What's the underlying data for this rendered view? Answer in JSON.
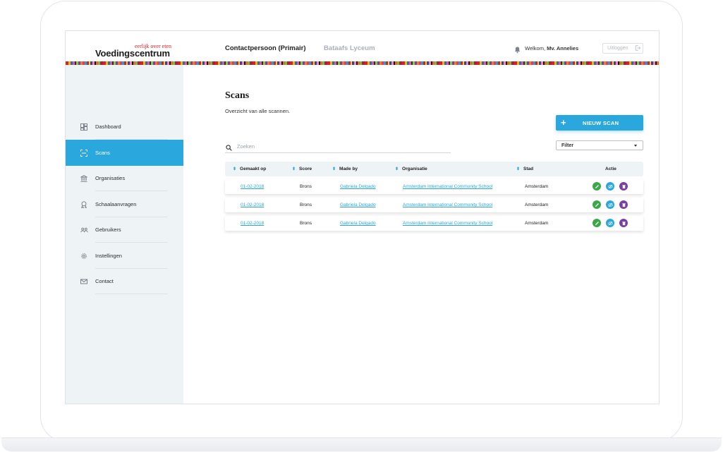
{
  "header": {
    "logo_tagline": "eerlijk over eten",
    "logo_name": "Voedingscentrum",
    "nav_primary": "Contactpersoon (Primair)",
    "nav_secondary": "Bataafs Lyceum",
    "welcome_prefix": "Welkom,",
    "welcome_name": "Mv. Annelies",
    "logout_label": "Uitloggen"
  },
  "sidebar": {
    "items": [
      {
        "label": "Dashboard",
        "icon": "dashboard-icon",
        "active": false
      },
      {
        "label": "Scans",
        "icon": "scan-icon",
        "active": true
      },
      {
        "label": "Organisaties",
        "icon": "bank-icon",
        "active": false
      },
      {
        "label": "Schaalaanvragen",
        "icon": "award-icon",
        "active": false
      },
      {
        "label": "Gebruikers",
        "icon": "users-icon",
        "active": false
      },
      {
        "label": "Instellingen",
        "icon": "gear-icon",
        "active": false
      },
      {
        "label": "Contact",
        "icon": "mail-icon",
        "active": false
      }
    ]
  },
  "main": {
    "title": "Scans",
    "subtitle": "Overzicht van alle scannen.",
    "new_button": "NIEUW SCAN",
    "search_placeholder": "Zoeken",
    "filter_label": "Filter"
  },
  "table": {
    "headers": [
      "Gemaakt op",
      "Score",
      "Made by",
      "Organisatie",
      "Stad",
      "Actie"
    ],
    "rows": [
      {
        "date": "01-02-2018",
        "score": "Brons",
        "made_by": "Gabriela Delgado",
        "organisatie": "Amsterdam International Community School",
        "stad": "Amsterdam"
      },
      {
        "date": "01-02-2018",
        "score": "Brons",
        "made_by": "Gabriela Delgado",
        "organisatie": "Amsterdam International Community School",
        "stad": "Amsterdam"
      },
      {
        "date": "01-02-2018",
        "score": "Brons",
        "made_by": "Gabriela Delgado",
        "organisatie": "Amsterdam International Community School",
        "stad": "Amsterdam"
      }
    ]
  },
  "colors": {
    "accent": "#2aa7dc",
    "brand_red": "#d2232a",
    "edit_action": "#3aa84a",
    "view_action": "#2aa7dc",
    "delete_action": "#7b3fa0"
  }
}
